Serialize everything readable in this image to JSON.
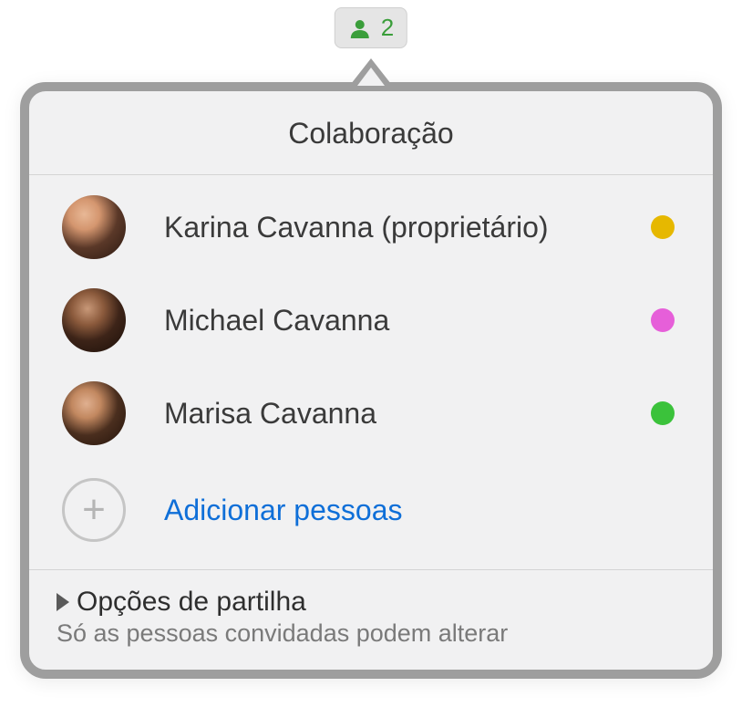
{
  "trigger": {
    "count": "2",
    "icon_color": "#3a9e3a"
  },
  "popover": {
    "title": "Colaboração"
  },
  "participants": [
    {
      "name": "Karina Cavanna (proprietário)",
      "dot_color": "#e6b800"
    },
    {
      "name": "Michael Cavanna",
      "dot_color": "#e65fd9"
    },
    {
      "name": "Marisa Cavanna",
      "dot_color": "#3bc23b"
    }
  ],
  "add_people": {
    "label": "Adicionar pessoas"
  },
  "share_options": {
    "title": "Opções de partilha",
    "subtitle": "Só as pessoas convidadas podem alterar"
  }
}
